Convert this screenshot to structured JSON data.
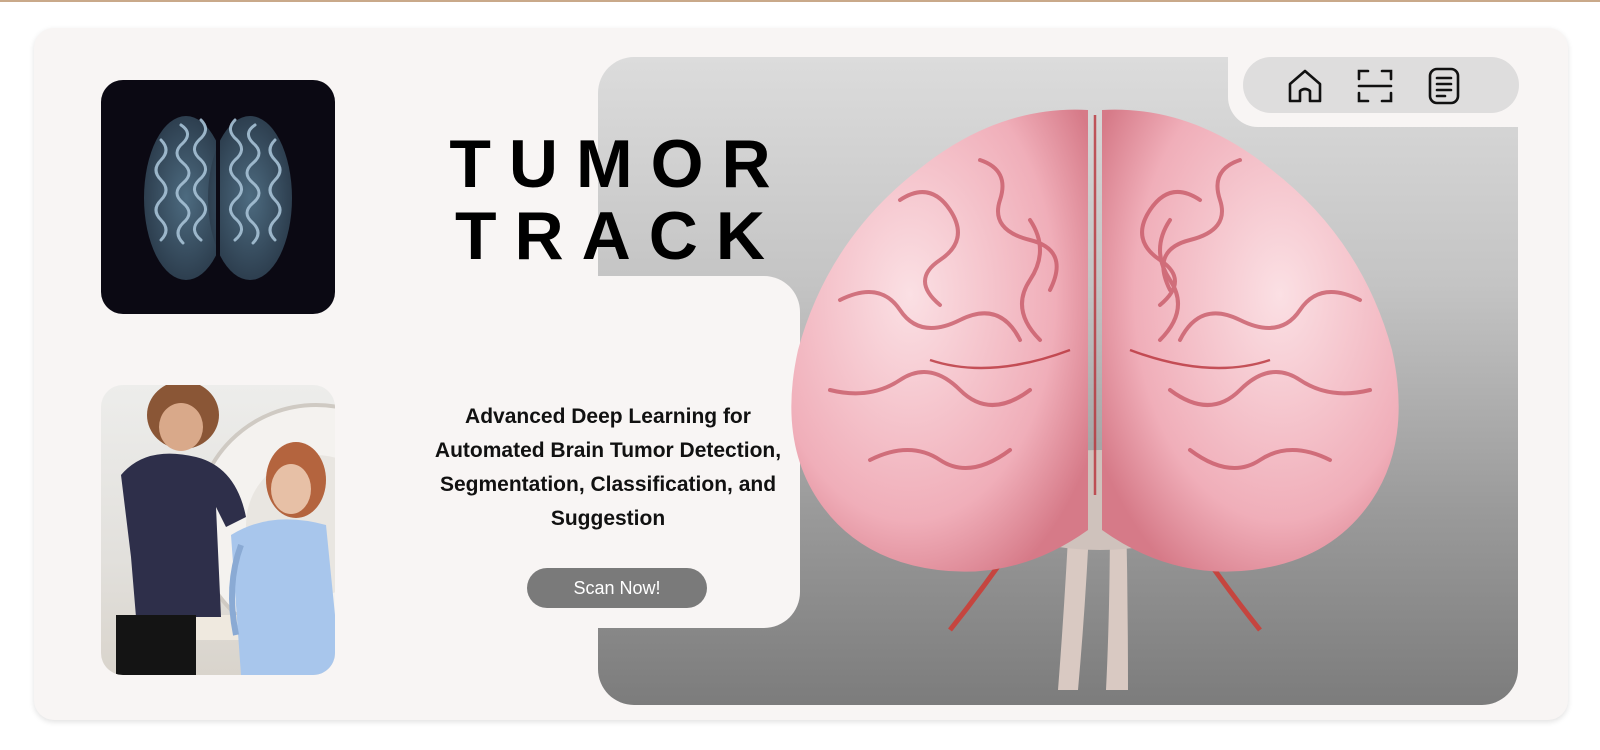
{
  "hero": {
    "title_line1": "TUMOR",
    "title_line2": "TRACK",
    "subtitle": "Advanced Deep Learning for Automated Brain Tumor Detection, Segmentation, Classification, and Suggestion",
    "cta_label": "Scan Now!"
  },
  "nav": {
    "items": [
      {
        "icon": "home-icon"
      },
      {
        "icon": "scan-icon"
      },
      {
        "icon": "document-list-icon"
      }
    ]
  },
  "colors": {
    "page_background": "#f8f5f4",
    "cta_background": "#7a7a7a",
    "nav_pill": "#dedddd",
    "brain_pink": "#f1b9c3",
    "brain_vessel": "#c5453f",
    "scan_background": "#0b0913"
  }
}
